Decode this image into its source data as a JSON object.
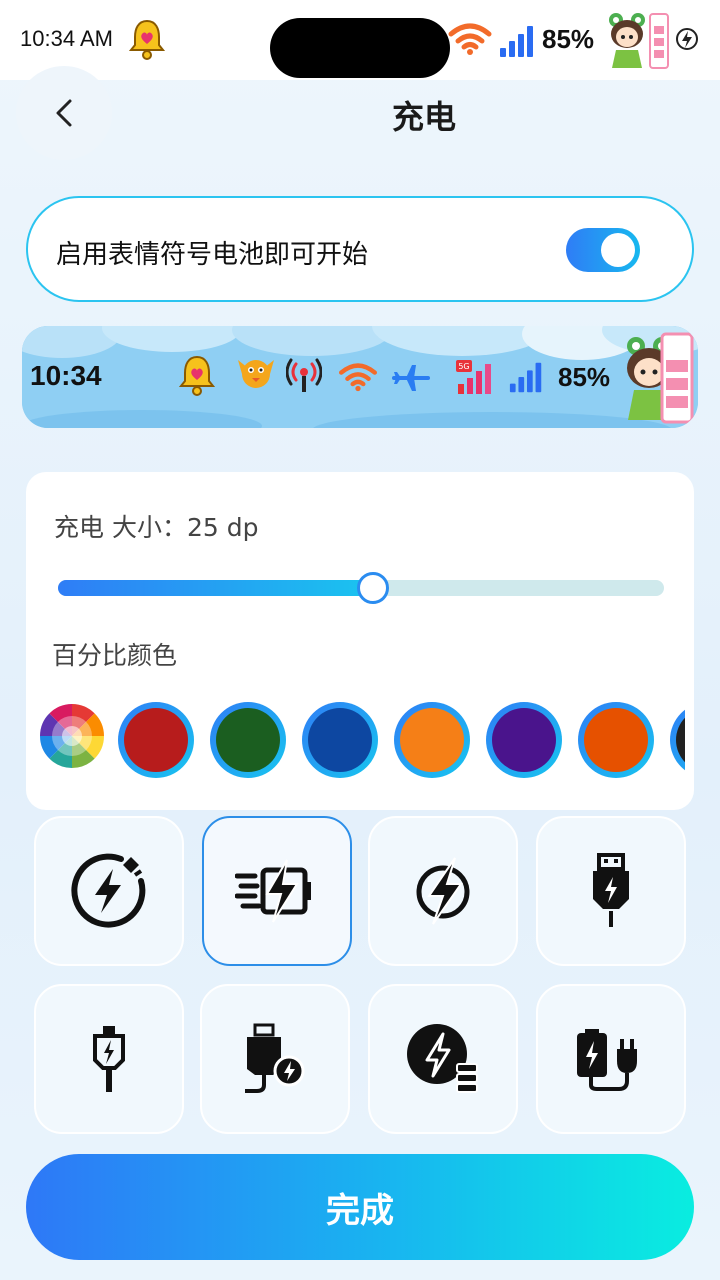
{
  "status_bar": {
    "time": "10:34 AM",
    "battery_percent": "85%",
    "icons": [
      "bell-icon",
      "wifi-icon",
      "signal-icon",
      "sticker-girl",
      "charging-icon"
    ]
  },
  "header": {
    "title": "充电"
  },
  "toggle": {
    "label": "启用表情符号电池即可开始",
    "enabled": true
  },
  "preview": {
    "time": "10:34",
    "battery_percent": "85%",
    "icons": [
      "bell-icon",
      "bird-icon",
      "hotspot-icon",
      "wifi-icon",
      "airplane-icon",
      "5g-signal-icon",
      "signal-icon",
      "sticker-girl"
    ]
  },
  "settings": {
    "size_label": "充电 大小：25 dp",
    "size_value_dp": 25,
    "size_fraction": 0.52,
    "color_label": "百分比颜色",
    "colors": [
      "#b71c1c",
      "#1b5e20",
      "#0d47a1",
      "#f57f17",
      "#4a148c",
      "#e65100",
      "#212121"
    ]
  },
  "charging_icons": {
    "selected_index": 1,
    "items": [
      "bolt-circle-plug-icon",
      "fast-charge-battery-icon",
      "bolt-circle-icon",
      "usb-bolt-icon",
      "usb-c-bolt-icon",
      "usb-plug-bolt-icon",
      "bolt-circle-battery-icon",
      "battery-plug-icon"
    ]
  },
  "accent": {
    "primary": "#2f7df6",
    "secondary": "#17c6ef"
  },
  "done_button": {
    "label": "完成"
  }
}
